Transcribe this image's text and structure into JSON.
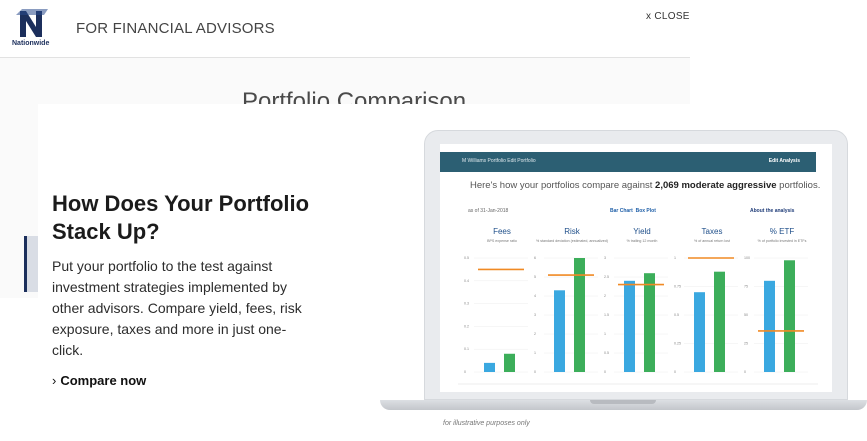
{
  "header": {
    "brand": "Nationwide",
    "title": "FOR FINANCIAL ADVISORS",
    "close_label": "x CLOSE"
  },
  "background_page": {
    "title": "Portfolio Comparison"
  },
  "promo": {
    "headline": "How Does Your Portfolio Stack Up?",
    "body": "Put your portfolio to the test against investment strategies implemented by other advisors. Compare yield, fees, risk exposure, taxes and more in just one-click.",
    "cta_label": "Compare now"
  },
  "laptop": {
    "disclaimer": "for illustrative purposes only"
  },
  "screen": {
    "top_bar_left": "M Williams Portfolio  Edit Portfolio",
    "top_bar_right": "Edit Analysis",
    "compare_prefix": "Here's how your portfolios compare against",
    "compare_count": "2,069",
    "compare_category": "moderate aggressive",
    "compare_suffix": "portfolios.",
    "date_label": "as of 31-Jan-2018",
    "toggle_bar": "Bar Chart",
    "toggle_box": "Box Plot",
    "about_label": "About the analysis"
  },
  "chart_data": {
    "type": "bar",
    "panels": [
      {
        "title": "Fees",
        "subtitle": "BPS expense ratio",
        "ticks": [
          "0.5",
          "0.4",
          "0.3",
          "0.2",
          "0.1",
          "0"
        ],
        "ymax": 0.5,
        "values": [
          0.04,
          0.08
        ],
        "benchmark": 0.45
      },
      {
        "title": "Risk",
        "subtitle": "% standard deviation (estimated, annualized)",
        "ticks": [
          "6",
          "5",
          "4",
          "3",
          "2",
          "1",
          "0"
        ],
        "ymax": 6,
        "values": [
          4.3,
          6.0
        ],
        "benchmark": 5.1
      },
      {
        "title": "Yield",
        "subtitle": "% trailing 12 month",
        "ticks": [
          "3",
          "2.5",
          "2",
          "1.5",
          "1",
          "0.5",
          "0"
        ],
        "ymax": 3,
        "values": [
          2.4,
          2.6
        ],
        "benchmark": 2.3
      },
      {
        "title": "Taxes",
        "subtitle": "% of annual return lost",
        "ticks": [
          "1",
          "0.75",
          "0.5",
          "0.25",
          "0"
        ],
        "ymax": 1,
        "values": [
          0.7,
          0.88
        ],
        "benchmark": 1.0
      },
      {
        "title": "% ETF",
        "subtitle": "% of portfolio invested in ETFs",
        "ticks": [
          "100",
          "75",
          "50",
          "25",
          "0"
        ],
        "ymax": 100,
        "values": [
          80,
          98
        ],
        "benchmark": 36
      }
    ],
    "series_colors": [
      "#3aa8e0",
      "#3cae5a"
    ],
    "benchmark_color": "#f08a24"
  }
}
